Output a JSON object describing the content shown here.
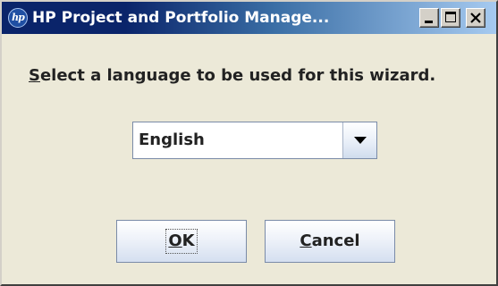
{
  "window": {
    "title": "HP Project and Portfolio Manage...",
    "app_icon_text": "hp"
  },
  "prompt": {
    "mnemonic": "S",
    "rest": "elect a language to be used for this wizard."
  },
  "language_select": {
    "selected": "English",
    "icon": "chevron-down-icon"
  },
  "buttons": {
    "ok_mnemonic": "O",
    "ok_rest": "K",
    "cancel_mnemonic": "C",
    "cancel_rest": "ancel"
  },
  "colors": {
    "titlebar_start": "#0a246a",
    "titlebar_end": "#a6caf0",
    "dialog_bg": "#ece9d8"
  }
}
